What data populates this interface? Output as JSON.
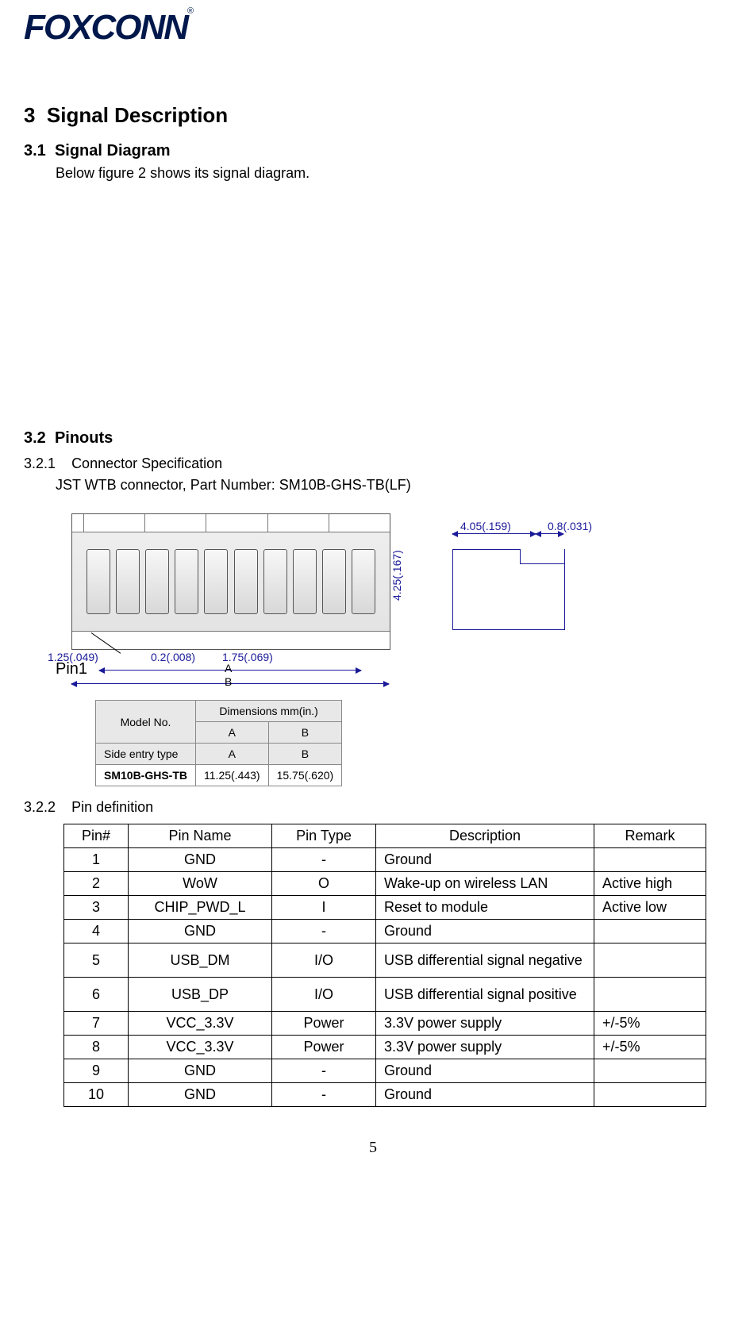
{
  "logo": {
    "text": "FOXCONN",
    "reg": "®"
  },
  "section": {
    "num": "3",
    "title": "Signal Description"
  },
  "sub31": {
    "num": "3.1",
    "title": "Signal Diagram",
    "body": "Below figure 2 shows its signal diagram."
  },
  "sub32": {
    "num": "3.2",
    "title": "Pinouts"
  },
  "sub321": {
    "num": "3.2.1",
    "title": "Connector Specification",
    "body": "JST WTB connector, Part Number: SM10B-GHS-TB(LF)"
  },
  "sub322": {
    "num": "3.2.2",
    "title": "Pin definition"
  },
  "diagram_dims": {
    "d1": "1.25(.049)",
    "d2": "0.2(.008)",
    "d3": "1.75(.069)",
    "A": "A",
    "B": "B",
    "h": "4.25(.167)",
    "top1": "4.05(.159)",
    "top2": "0.8(.031)",
    "pin1": "Pin1"
  },
  "dim_table": {
    "h1": "Model No.",
    "h2": "Dimensions mm(in.)",
    "row2c1": "Side entry type",
    "A": "A",
    "B": "B",
    "model": "SM10B-GHS-TB",
    "va": "11.25(.443)",
    "vb": "15.75(.620)"
  },
  "pin_table": {
    "headers": [
      "Pin#",
      "Pin Name",
      "Pin Type",
      "Description",
      "Remark"
    ],
    "rows": [
      {
        "num": "1",
        "name": "GND",
        "type": "-",
        "desc": "Ground",
        "remark": ""
      },
      {
        "num": "2",
        "name": "WoW",
        "type": "O",
        "desc": "Wake-up on wireless LAN",
        "remark": "Active high"
      },
      {
        "num": "3",
        "name": "CHIP_PWD_L",
        "type": "I",
        "desc": "Reset to module",
        "remark": "Active low"
      },
      {
        "num": "4",
        "name": "GND",
        "type": "-",
        "desc": "Ground",
        "remark": ""
      },
      {
        "num": "5",
        "name": "USB_DM",
        "type": "I/O",
        "desc": "USB differential signal negative",
        "remark": "",
        "tall": true
      },
      {
        "num": "6",
        "name": "USB_DP",
        "type": "I/O",
        "desc": "USB differential signal positive",
        "remark": "",
        "tall": true
      },
      {
        "num": "7",
        "name": "VCC_3.3V",
        "type": "Power",
        "desc": "3.3V power supply",
        "remark": "+/-5%"
      },
      {
        "num": "8",
        "name": "VCC_3.3V",
        "type": "Power",
        "desc": "3.3V power supply",
        "remark": "+/-5%"
      },
      {
        "num": "9",
        "name": "GND",
        "type": "-",
        "desc": "Ground",
        "remark": ""
      },
      {
        "num": "10",
        "name": "GND",
        "type": "-",
        "desc": "Ground",
        "remark": ""
      }
    ]
  },
  "page_num": "5"
}
